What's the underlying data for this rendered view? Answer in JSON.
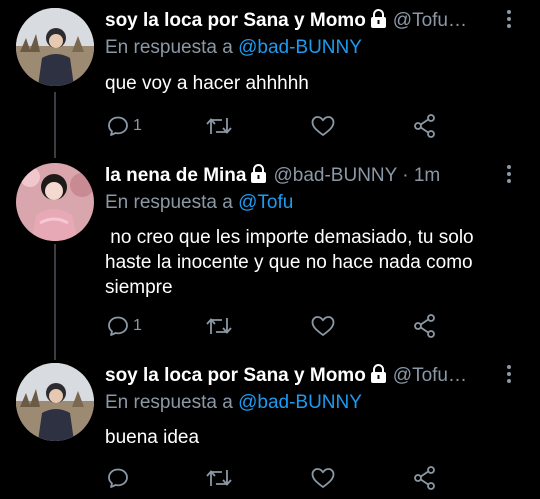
{
  "colors": {
    "background": "#000000",
    "mention": "#1d9bf0",
    "muted": "#8b98a5",
    "thread_line": "#3a3d41"
  },
  "tweets": [
    {
      "name": "soy la loca por Sana y Momo",
      "handle": "@Tofu…",
      "reply_prefix": "En respuesta a",
      "reply_to": "@bad-BUNNY",
      "text": "que voy a hacer ahhhhh",
      "reply_count": "1",
      "protected_icon": "lock-icon"
    },
    {
      "name": "la nena de Mina",
      "handle": "@bad-BUNNY · 1m",
      "reply_prefix": "En respuesta a",
      "reply_to": "@Tofu",
      "text": " no creo que les importe demasiado, tu solo haste la inocente y que no hace nada como siempre",
      "reply_count": "1",
      "protected_icon": "lock-icon"
    },
    {
      "name": "soy la loca por Sana y Momo",
      "handle": "@Tofu…",
      "reply_prefix": "En respuesta a",
      "reply_to": "@bad-BUNNY",
      "text": "buena idea",
      "reply_count": "",
      "protected_icon": "lock-icon"
    }
  ]
}
